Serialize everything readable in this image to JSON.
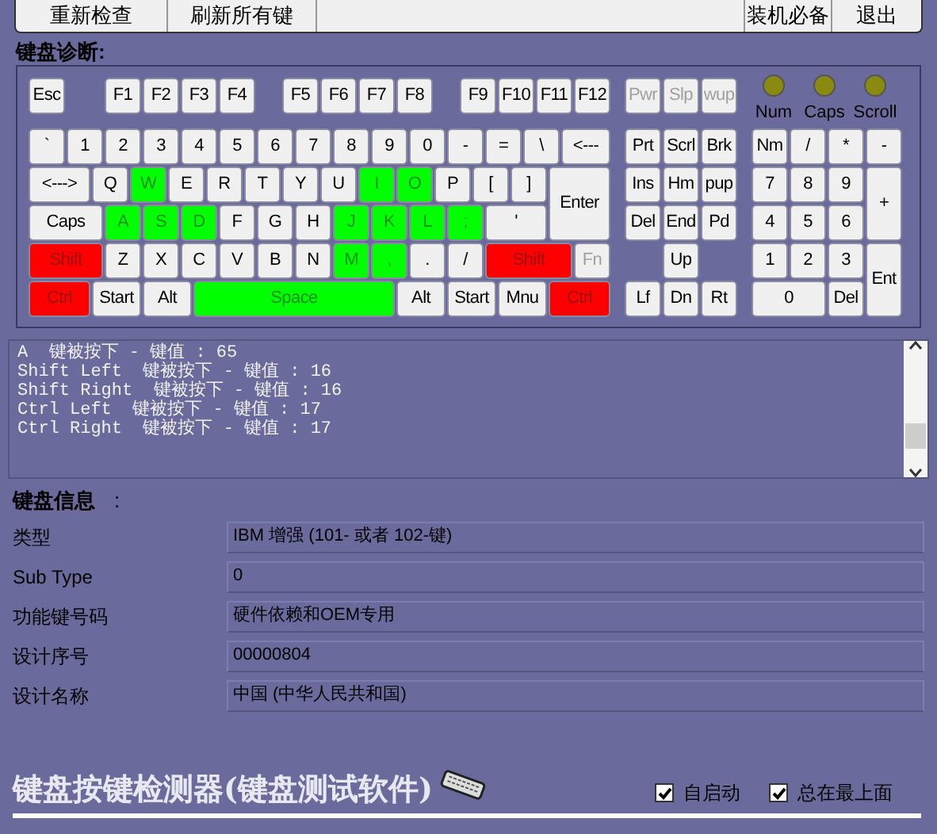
{
  "toolbar": {
    "buttons": [
      {
        "label": "重新检查"
      },
      {
        "label": "刷新所有键"
      },
      {
        "label": "装机必备"
      },
      {
        "label": "退出"
      }
    ]
  },
  "diagnosis": {
    "title": "键盘诊断:",
    "keyboard": {
      "key_lines": [
        {
          "keys": [
            {
              "label": "Esc",
              "pressed": false,
              "held": false,
              "disabled": false
            },
            {
              "label": "F1",
              "pressed": false,
              "held": false,
              "disabled": false
            },
            {
              "label": "F2",
              "pressed": false,
              "held": false,
              "disabled": false
            },
            {
              "label": "F3",
              "pressed": false,
              "held": false,
              "disabled": false
            },
            {
              "label": "F4",
              "pressed": false,
              "held": false,
              "disabled": false
            },
            {
              "label": "F5",
              "pressed": false,
              "held": false,
              "disabled": false
            },
            {
              "label": "F6",
              "pressed": false,
              "held": false,
              "disabled": false
            },
            {
              "label": "F7",
              "pressed": false,
              "held": false,
              "disabled": false
            },
            {
              "label": "F8",
              "pressed": false,
              "held": false,
              "disabled": false
            },
            {
              "label": "F9",
              "pressed": false,
              "held": false,
              "disabled": false
            },
            {
              "label": "F10",
              "pressed": false,
              "held": false,
              "disabled": false
            },
            {
              "label": "F11",
              "pressed": false,
              "held": false,
              "disabled": false
            },
            {
              "label": "F12",
              "pressed": false,
              "held": false,
              "disabled": false
            },
            {
              "label": "Pwr",
              "pressed": false,
              "held": false,
              "disabled": true
            },
            {
              "label": "Slp",
              "pressed": false,
              "held": false,
              "disabled": true
            },
            {
              "label": "wup",
              "pressed": false,
              "held": false,
              "disabled": true
            }
          ]
        },
        {
          "keys": [
            {
              "label": "`",
              "pressed": false,
              "held": false,
              "disabled": false
            },
            {
              "label": "1",
              "pressed": false,
              "held": false,
              "disabled": false
            },
            {
              "label": "2",
              "pressed": false,
              "held": false,
              "disabled": false
            },
            {
              "label": "3",
              "pressed": false,
              "held": false,
              "disabled": false
            },
            {
              "label": "4",
              "pressed": false,
              "held": false,
              "disabled": false
            },
            {
              "label": "5",
              "pressed": false,
              "held": false,
              "disabled": false
            },
            {
              "label": "6",
              "pressed": false,
              "held": false,
              "disabled": false
            },
            {
              "label": "7",
              "pressed": false,
              "held": false,
              "disabled": false
            },
            {
              "label": "8",
              "pressed": false,
              "held": false,
              "disabled": false
            },
            {
              "label": "9",
              "pressed": false,
              "held": false,
              "disabled": false
            },
            {
              "label": "0",
              "pressed": false,
              "held": false,
              "disabled": false
            },
            {
              "label": "-",
              "pressed": false,
              "held": false,
              "disabled": false
            },
            {
              "label": "=",
              "pressed": false,
              "held": false,
              "disabled": false
            },
            {
              "label": "\\",
              "pressed": false,
              "held": false,
              "disabled": false
            },
            {
              "label": "<---",
              "pressed": false,
              "held": false,
              "disabled": false
            },
            {
              "label": "Prt",
              "pressed": false,
              "held": false,
              "disabled": false
            },
            {
              "label": "Scrl",
              "pressed": false,
              "held": false,
              "disabled": false
            },
            {
              "label": "Brk",
              "pressed": false,
              "held": false,
              "disabled": false
            },
            {
              "label": "Nm",
              "pressed": false,
              "held": false,
              "disabled": false
            },
            {
              "label": "/",
              "pressed": false,
              "held": false,
              "disabled": false
            },
            {
              "label": "*",
              "pressed": false,
              "held": false,
              "disabled": false
            },
            {
              "label": "-",
              "pressed": false,
              "held": false,
              "disabled": false
            }
          ]
        },
        {
          "keys": [
            {
              "label": "<--->",
              "pressed": false,
              "held": false,
              "disabled": false
            },
            {
              "label": "Q",
              "pressed": false,
              "held": false,
              "disabled": false
            },
            {
              "label": "W",
              "pressed": true,
              "held": false,
              "disabled": false
            },
            {
              "label": "E",
              "pressed": false,
              "held": false,
              "disabled": false
            },
            {
              "label": "R",
              "pressed": false,
              "held": false,
              "disabled": false
            },
            {
              "label": "T",
              "pressed": false,
              "held": false,
              "disabled": false
            },
            {
              "label": "Y",
              "pressed": false,
              "held": false,
              "disabled": false
            },
            {
              "label": "U",
              "pressed": false,
              "held": false,
              "disabled": false
            },
            {
              "label": "I",
              "pressed": true,
              "held": false,
              "disabled": false
            },
            {
              "label": "O",
              "pressed": true,
              "held": false,
              "disabled": false
            },
            {
              "label": "P",
              "pressed": false,
              "held": false,
              "disabled": false
            },
            {
              "label": "[",
              "pressed": false,
              "held": false,
              "disabled": false
            },
            {
              "label": "]",
              "pressed": false,
              "held": false,
              "disabled": false
            },
            {
              "label": "Enter",
              "pressed": false,
              "held": false,
              "disabled": false
            },
            {
              "label": "Ins",
              "pressed": false,
              "held": false,
              "disabled": false
            },
            {
              "label": "Hm",
              "pressed": false,
              "held": false,
              "disabled": false
            },
            {
              "label": "pup",
              "pressed": false,
              "held": false,
              "disabled": false
            },
            {
              "label": "7",
              "pressed": false,
              "held": false,
              "disabled": false
            },
            {
              "label": "8",
              "pressed": false,
              "held": false,
              "disabled": false
            },
            {
              "label": "9",
              "pressed": false,
              "held": false,
              "disabled": false
            },
            {
              "label": "+",
              "pressed": false,
              "held": false,
              "disabled": false
            }
          ]
        },
        {
          "keys": [
            {
              "label": "Caps",
              "pressed": false,
              "held": false,
              "disabled": false
            },
            {
              "label": "A",
              "pressed": true,
              "held": false,
              "disabled": false
            },
            {
              "label": "S",
              "pressed": true,
              "held": false,
              "disabled": false
            },
            {
              "label": "D",
              "pressed": true,
              "held": false,
              "disabled": false
            },
            {
              "label": "F",
              "pressed": false,
              "held": false,
              "disabled": false
            },
            {
              "label": "G",
              "pressed": false,
              "held": false,
              "disabled": false
            },
            {
              "label": "H",
              "pressed": false,
              "held": false,
              "disabled": false
            },
            {
              "label": "J",
              "pressed": true,
              "held": false,
              "disabled": false
            },
            {
              "label": "K",
              "pressed": true,
              "held": false,
              "disabled": false
            },
            {
              "label": "L",
              "pressed": true,
              "held": false,
              "disabled": false
            },
            {
              "label": ";",
              "pressed": true,
              "held": false,
              "disabled": false
            },
            {
              "label": "'",
              "pressed": false,
              "held": false,
              "disabled": false
            },
            {
              "label": "Del",
              "pressed": false,
              "held": false,
              "disabled": false
            },
            {
              "label": "End",
              "pressed": false,
              "held": false,
              "disabled": false
            },
            {
              "label": "Pd",
              "pressed": false,
              "held": false,
              "disabled": false
            },
            {
              "label": "4",
              "pressed": false,
              "held": false,
              "disabled": false
            },
            {
              "label": "5",
              "pressed": false,
              "held": false,
              "disabled": false
            },
            {
              "label": "6",
              "pressed": false,
              "held": false,
              "disabled": false
            }
          ]
        },
        {
          "keys": [
            {
              "label": "Shift",
              "pressed": false,
              "held": true,
              "disabled": false
            },
            {
              "label": "Z",
              "pressed": false,
              "held": false,
              "disabled": false
            },
            {
              "label": "X",
              "pressed": false,
              "held": false,
              "disabled": false
            },
            {
              "label": "C",
              "pressed": false,
              "held": false,
              "disabled": false
            },
            {
              "label": "V",
              "pressed": false,
              "held": false,
              "disabled": false
            },
            {
              "label": "B",
              "pressed": false,
              "held": false,
              "disabled": false
            },
            {
              "label": "N",
              "pressed": false,
              "held": false,
              "disabled": false
            },
            {
              "label": "M",
              "pressed": true,
              "held": false,
              "disabled": false
            },
            {
              "label": ",",
              "pressed": true,
              "held": false,
              "disabled": false
            },
            {
              "label": ".",
              "pressed": false,
              "held": false,
              "disabled": false
            },
            {
              "label": "/",
              "pressed": false,
              "held": false,
              "disabled": false
            },
            {
              "label": "Shift",
              "pressed": false,
              "held": true,
              "disabled": false
            },
            {
              "label": "Fn",
              "pressed": false,
              "held": false,
              "disabled": true
            },
            {
              "label": "Up",
              "pressed": false,
              "held": false,
              "disabled": false
            },
            {
              "label": "1",
              "pressed": false,
              "held": false,
              "disabled": false
            },
            {
              "label": "2",
              "pressed": false,
              "held": false,
              "disabled": false
            },
            {
              "label": "3",
              "pressed": false,
              "held": false,
              "disabled": false
            },
            {
              "label": "Ent",
              "pressed": false,
              "held": false,
              "disabled": false
            }
          ]
        },
        {
          "keys": [
            {
              "label": "Ctrl",
              "pressed": false,
              "held": true,
              "disabled": false
            },
            {
              "label": "Start",
              "pressed": false,
              "held": false,
              "disabled": false
            },
            {
              "label": "Alt",
              "pressed": false,
              "held": false,
              "disabled": false
            },
            {
              "label": "Space",
              "pressed": true,
              "held": false,
              "disabled": false
            },
            {
              "label": "Alt",
              "pressed": false,
              "held": false,
              "disabled": false
            },
            {
              "label": "Start",
              "pressed": false,
              "held": false,
              "disabled": false
            },
            {
              "label": "Mnu",
              "pressed": false,
              "held": false,
              "disabled": false
            },
            {
              "label": "Ctrl",
              "pressed": false,
              "held": true,
              "disabled": false
            },
            {
              "label": "Lf",
              "pressed": false,
              "held": false,
              "disabled": false
            },
            {
              "label": "Dn",
              "pressed": false,
              "held": false,
              "disabled": false
            },
            {
              "label": "Rt",
              "pressed": false,
              "held": false,
              "disabled": false
            },
            {
              "label": "0",
              "pressed": false,
              "held": false,
              "disabled": false
            },
            {
              "label": "Del",
              "pressed": false,
              "held": false,
              "disabled": false
            }
          ]
        }
      ]
    },
    "leds": [
      {
        "label": "Num",
        "on": false
      },
      {
        "label": "Caps",
        "on": false
      },
      {
        "label": "Scroll",
        "on": false
      }
    ]
  },
  "log": {
    "lines": [
      "A  键被按下 - 键值 : 65",
      "Shift Left  键被按下 - 键值 : 16",
      "Shift Right  键被按下 - 键值 : 16",
      "Ctrl Left  键被按下 - 键值 : 17",
      "Ctrl Right  键被按下 - 键值 : 17"
    ]
  },
  "info": {
    "title": "键盘信息",
    "colon": ":",
    "rows": [
      {
        "label": "类型",
        "value": "IBM 增强 (101- 或者 102-键)"
      },
      {
        "label": "Sub Type",
        "value": "0"
      },
      {
        "label": "功能键号码",
        "value": "硬件依赖和OEM专用"
      },
      {
        "label": "设计序号",
        "value": "00000804"
      },
      {
        "label": "设计名称",
        "value": "中国 (中华人民共和国)"
      }
    ]
  },
  "footer": {
    "title": "键盘按键检测器(键盘测试软件)",
    "options": [
      {
        "label": "自启动",
        "checked": true
      },
      {
        "label": "总在最上面",
        "checked": true
      }
    ]
  }
}
